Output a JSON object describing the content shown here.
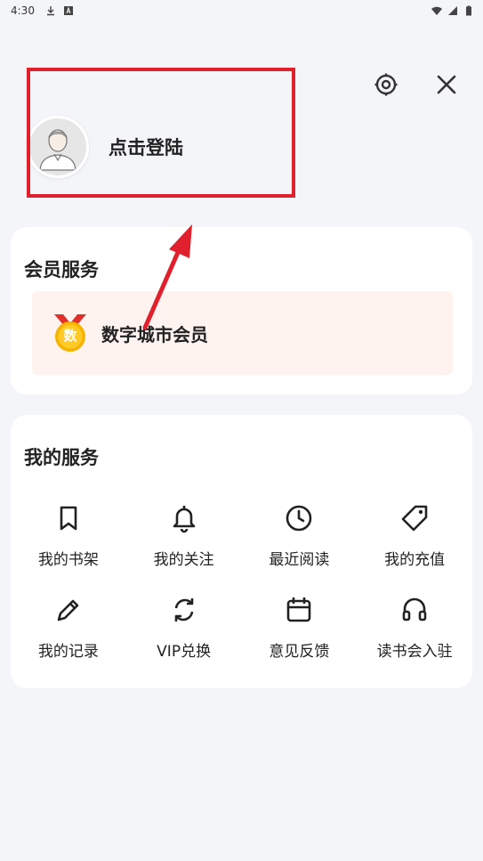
{
  "status_bar": {
    "time": "4:30",
    "icons": [
      "download-icon",
      "app-notification-icon",
      "wifi-icon",
      "signal-icon",
      "battery-icon"
    ]
  },
  "top_actions": {
    "settings_icon": "settings-icon",
    "close_icon": "close-icon"
  },
  "profile": {
    "login_text": "点击登陆",
    "avatar_icon": "avatar-icon"
  },
  "annotation": {
    "box_color": "#e0202c",
    "arrow_color": "#e0202c"
  },
  "member_services": {
    "title": "会员服务",
    "item": {
      "badge_text": "数",
      "label": "数字城市会员"
    }
  },
  "my_services": {
    "title": "我的服务",
    "items": [
      {
        "label": "我的书架",
        "icon": "bookmark-icon"
      },
      {
        "label": "我的关注",
        "icon": "bell-icon"
      },
      {
        "label": "最近阅读",
        "icon": "clock-icon"
      },
      {
        "label": "我的充值",
        "icon": "tag-icon"
      },
      {
        "label": "我的记录",
        "icon": "pencil-icon"
      },
      {
        "label": "VIP兑换",
        "icon": "refresh-icon"
      },
      {
        "label": "意见反馈",
        "icon": "calendar-icon"
      },
      {
        "label": "读书会入驻",
        "icon": "headset-icon"
      }
    ]
  },
  "colors": {
    "background": "#f4f5f9",
    "card": "#ffffff",
    "member_item_bg": "#fff3f0",
    "badge_gold": "#f5b400",
    "badge_ribbon": "#e0302c"
  }
}
